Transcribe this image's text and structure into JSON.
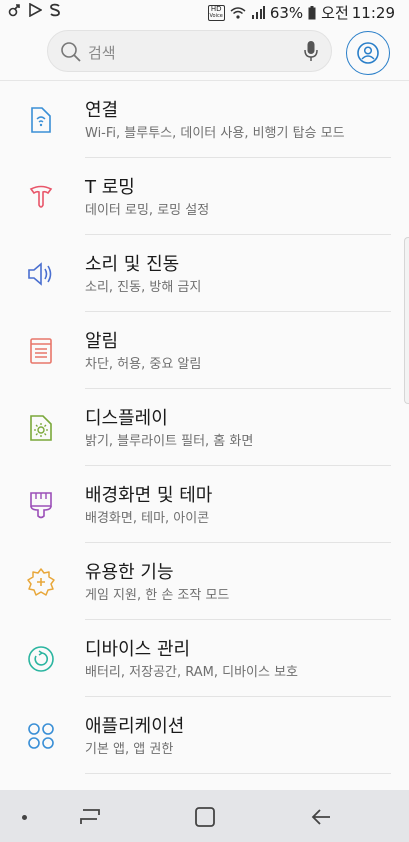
{
  "status_bar": {
    "left_icons": [
      "link-icon",
      "play-icon",
      "s-icon"
    ],
    "hd_text": "HD",
    "volte_text": "Voice",
    "battery": "63%",
    "ampm": "오전",
    "time": "11:29"
  },
  "search": {
    "placeholder": "검색"
  },
  "accent_color": "#2a7fc9",
  "items": [
    {
      "title": "연결",
      "subtitle": "Wi-Fi, 블루투스, 데이터 사용, 비행기 탑승 모드",
      "icon": "connections-icon",
      "color": "#3a8fd6"
    },
    {
      "title": "T 로밍",
      "subtitle": "데이터 로밍, 로밍 설정",
      "icon": "t-roaming-icon",
      "color": "#e8566a"
    },
    {
      "title": "소리 및 진동",
      "subtitle": "소리, 진동, 방해 금지",
      "icon": "speaker-icon",
      "color": "#4a6fd0"
    },
    {
      "title": "알림",
      "subtitle": "차단, 허용, 중요 알림",
      "icon": "notification-icon",
      "color": "#e8766a"
    },
    {
      "title": "디스플레이",
      "subtitle": "밝기, 블루라이트 필터, 홈 화면",
      "icon": "display-icon",
      "color": "#7aa83a"
    },
    {
      "title": "배경화면 및 테마",
      "subtitle": "배경화면, 테마, 아이콘",
      "icon": "brush-icon",
      "color": "#9b4fb8"
    },
    {
      "title": "유용한 기능",
      "subtitle": "게임 지원, 한 손 조작 모드",
      "icon": "gear-plus-icon",
      "color": "#e8a73a"
    },
    {
      "title": "디바이스 관리",
      "subtitle": "배터리, 저장공간, RAM, 디바이스 보호",
      "icon": "device-care-icon",
      "color": "#2bb5a0"
    },
    {
      "title": "애플리케이션",
      "subtitle": "기본 앱, 앱 권한",
      "icon": "apps-icon",
      "color": "#3a8fd6"
    }
  ],
  "nav": [
    "recent-apps-icon",
    "home-icon",
    "back-icon"
  ]
}
